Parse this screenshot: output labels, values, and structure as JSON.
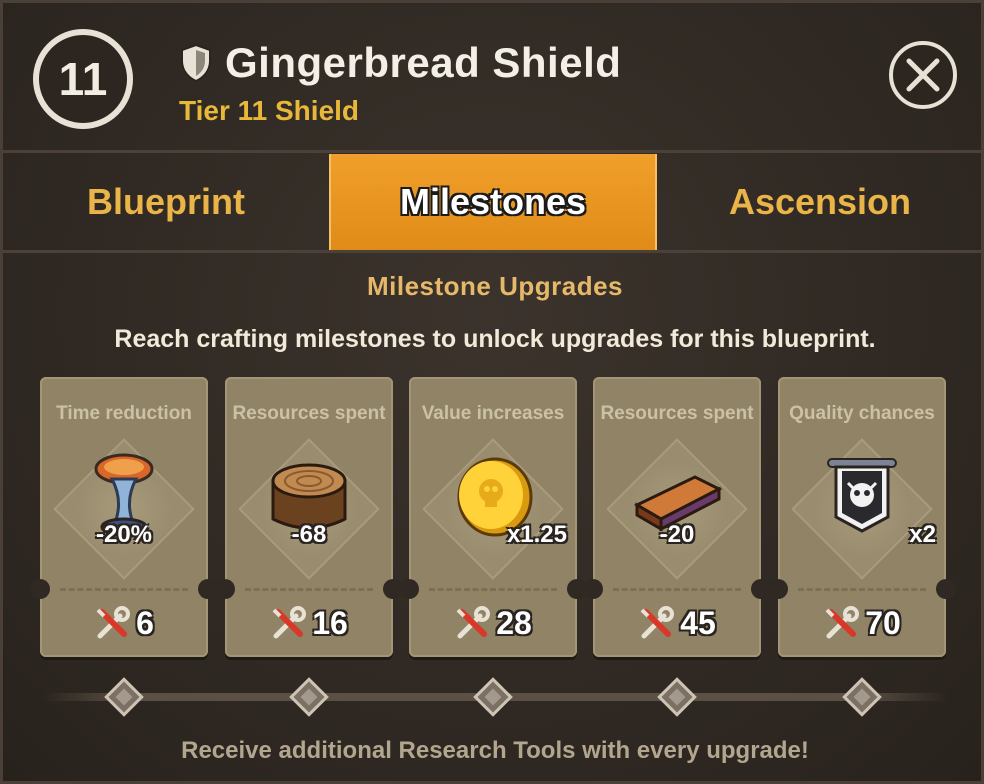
{
  "header": {
    "level": "11",
    "title": "Gingerbread Shield",
    "subtitle": "Tier 11 Shield",
    "item_icon": "shield-icon",
    "close_icon": "close-icon"
  },
  "tabs": [
    {
      "label": "Blueprint",
      "active": false
    },
    {
      "label": "Milestones",
      "active": true
    },
    {
      "label": "Ascension",
      "active": false
    }
  ],
  "section": {
    "title": "Milestone Upgrades",
    "description": "Reach crafting milestones to unlock upgrades for this blueprint."
  },
  "milestones": [
    {
      "label": "Time reduction",
      "value": "-20%",
      "cost": "6",
      "icon": "hourglass-icon"
    },
    {
      "label": "Resources spent",
      "value": "-68",
      "cost": "16",
      "icon": "wood-log-icon"
    },
    {
      "label": "Value increases",
      "value": "x1.25",
      "cost": "28",
      "icon": "gold-coin-icon"
    },
    {
      "label": "Resources spent",
      "value": "-20",
      "cost": "45",
      "icon": "wood-plank-icon"
    },
    {
      "label": "Quality chances",
      "value": "x2",
      "cost": "70",
      "icon": "skull-banner-icon"
    }
  ],
  "footer": "Receive additional Research Tools with every upgrade!",
  "colors": {
    "accent": "#e08b18",
    "gold_text": "#e8b83a",
    "card": "#918466"
  }
}
